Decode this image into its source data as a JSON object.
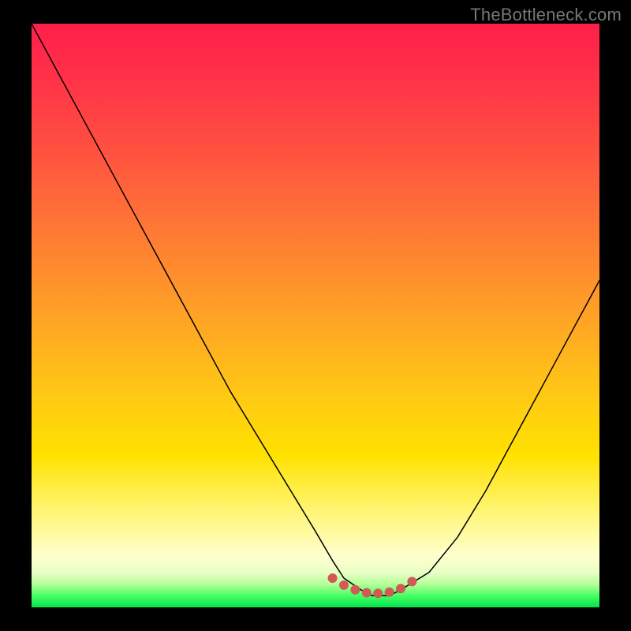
{
  "watermark": "TheBottleneck.com",
  "colors": {
    "background": "#000000",
    "curve": "#000000",
    "dots": "#d15a57",
    "gradient_stops": [
      "#ff1f4a",
      "#ff7a34",
      "#ffe200",
      "#ffffcd",
      "#00e34e"
    ]
  },
  "chart_data": {
    "type": "line",
    "title": "",
    "xlabel": "",
    "ylabel": "",
    "xlim": [
      0,
      100
    ],
    "ylim": [
      0,
      100
    ],
    "grid": false,
    "legend": false,
    "series": [
      {
        "name": "bottleneck-curve",
        "x": [
          0,
          5,
          10,
          15,
          20,
          25,
          30,
          35,
          40,
          45,
          50,
          53,
          55,
          58,
          60,
          63,
          65,
          70,
          75,
          80,
          85,
          90,
          95,
          100
        ],
        "y": [
          100,
          91,
          82,
          73,
          64,
          55,
          46,
          37,
          29,
          21,
          13,
          8,
          5,
          3,
          2,
          2,
          3,
          6,
          12,
          20,
          29,
          38,
          47,
          56
        ]
      }
    ],
    "markers": {
      "name": "valley-dots",
      "x": [
        53,
        55,
        57,
        59,
        61,
        63,
        65,
        67
      ],
      "y": [
        5,
        3.8,
        3.0,
        2.5,
        2.4,
        2.6,
        3.2,
        4.4
      ]
    }
  }
}
